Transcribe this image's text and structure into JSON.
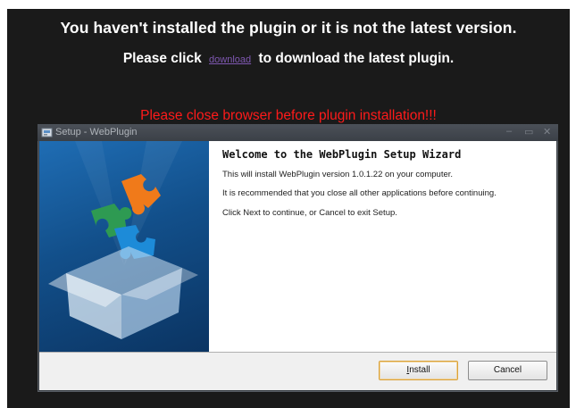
{
  "banner": {
    "line1": "You haven't installed the plugin or it is not the latest version.",
    "line2_prefix": "Please click",
    "download_link": "download",
    "line2_suffix": "to download the latest plugin.",
    "warning": "Please close browser before plugin installation!!!"
  },
  "dialog": {
    "title": "Setup - WebPlugin",
    "heading": "Welcome to the WebPlugin Setup Wizard",
    "paragraphs": [
      "This will install WebPlugin version 1.0.1.22 on your computer.",
      "It is recommended that you close all other applications before continuing.",
      "Click Next to continue, or Cancel to exit Setup."
    ],
    "install_label_first": "I",
    "install_label_rest": "nstall",
    "cancel_label": "Cancel",
    "window_controls": {
      "minimize": "–",
      "maximize": "▭",
      "close": "✕"
    }
  },
  "colors": {
    "background": "#1a1a1a",
    "warning": "#ff1a1a",
    "link": "#7f58b2"
  }
}
